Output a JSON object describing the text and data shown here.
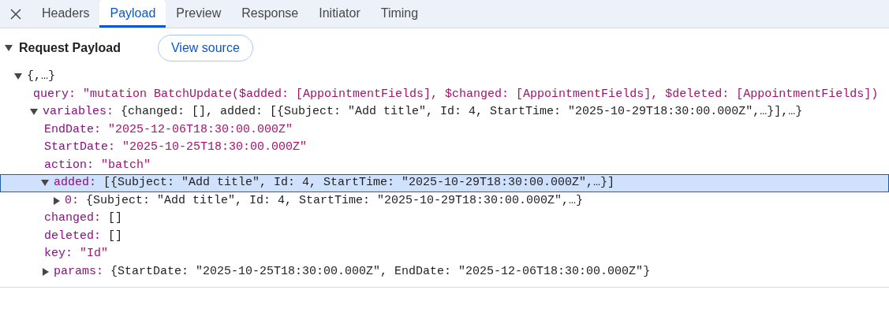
{
  "tabs": [
    {
      "label": "Headers",
      "selected": false
    },
    {
      "label": "Payload",
      "selected": true
    },
    {
      "label": "Preview",
      "selected": false
    },
    {
      "label": "Response",
      "selected": false
    },
    {
      "label": "Initiator",
      "selected": false
    },
    {
      "label": "Timing",
      "selected": false
    }
  ],
  "section": {
    "title": "Request Payload",
    "expanded": true,
    "button": "View source"
  },
  "tree": [
    {
      "value": "{,…}",
      "kind": "preview",
      "expanded": true,
      "selected": false,
      "children": [
        {
          "key": "query:",
          "value": "\"mutation BatchUpdate($added: [AppointmentFields], $changed: [AppointmentFields], $deleted: [AppointmentFields])",
          "kind": "string"
        },
        {
          "key": "variables:",
          "value": "{changed: [], added: [{Subject: \"Add title\", Id: 4, StartTime: \"2025-10-29T18:30:00.000Z\",…}],…}",
          "kind": "preview",
          "expanded": true,
          "selected": false,
          "children": [
            {
              "key": "EndDate:",
              "value": "\"2025-12-06T18:30:00.000Z\"",
              "kind": "string"
            },
            {
              "key": "StartDate:",
              "value": "\"2025-10-25T18:30:00.000Z\"",
              "kind": "string"
            },
            {
              "key": "action:",
              "value": "\"batch\"",
              "kind": "string"
            },
            {
              "key": "added:",
              "value": "[{Subject: \"Add title\", Id: 4, StartTime: \"2025-10-29T18:30:00.000Z\",…}]",
              "kind": "preview",
              "expanded": true,
              "selected": true,
              "children": [
                {
                  "key": "0:",
                  "value": "{Subject: \"Add title\", Id: 4, StartTime: \"2025-10-29T18:30:00.000Z\",…}",
                  "kind": "preview",
                  "expanded": false,
                  "selected": false
                }
              ]
            },
            {
              "key": "changed:",
              "value": "[]",
              "kind": "preview"
            },
            {
              "key": "deleted:",
              "value": "[]",
              "kind": "preview"
            },
            {
              "key": "key:",
              "value": "\"Id\"",
              "kind": "string"
            },
            {
              "key": "params:",
              "value": "{StartDate: \"2025-10-25T18:30:00.000Z\", EndDate: \"2025-12-06T18:30:00.000Z\"}",
              "kind": "preview",
              "expanded": false,
              "selected": false
            }
          ]
        }
      ]
    }
  ]
}
